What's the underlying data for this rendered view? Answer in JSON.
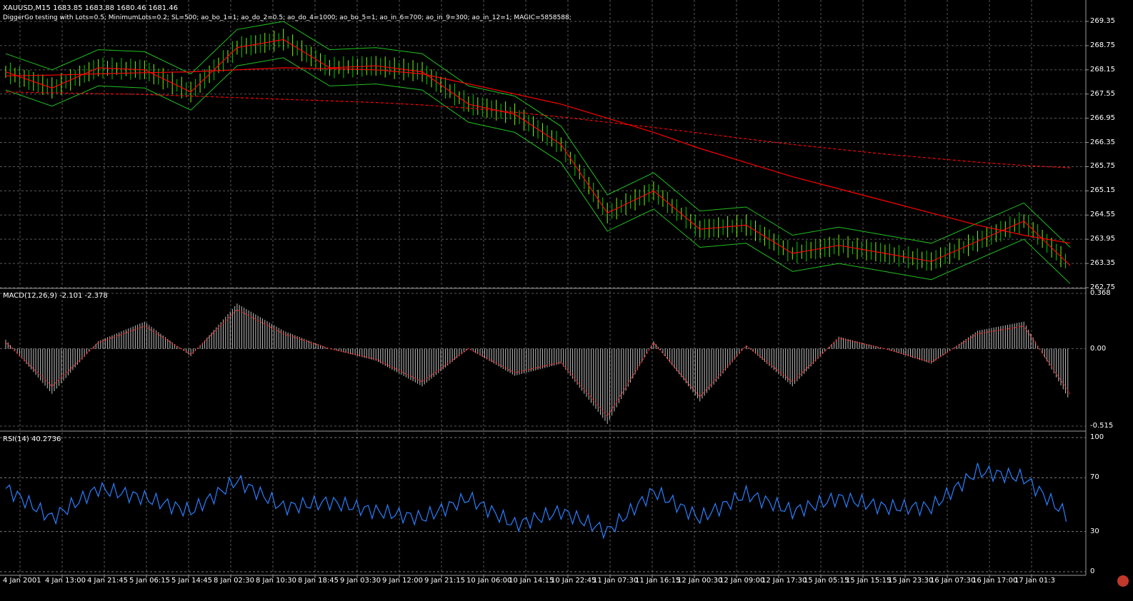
{
  "colors": {
    "background": "#000000",
    "grid": "#7f7f7f",
    "axis_text": "#ffffff",
    "candle_up": "#00d000",
    "candle_down": "#7CFC00",
    "moving_average": "#ff0000",
    "bollinger": "#20c020",
    "macd_hist": "#c0c0c0",
    "macd_signal": "#ff2020",
    "rsi_line": "#2a7fff",
    "rsi_level": "#9a9a9a"
  },
  "main_pane": {
    "symbol_label": "XAUUSD,M15  1683.85 1683.88 1680.46 1681.46",
    "ea_label": "DiggerGo testing with Lots=0.5; MinimumLots=0.2; SL=500; ao_bo_1=1; ao_do_2=0.5; ao_do_4=1000; ao_bo_5=1; ao_in_6=700; ao_in_9=300; ao_in_12=1; MAGIC=5858588;"
  },
  "macd_pane": {
    "label": "MACD(12,26,9) -2.101 -2.378"
  },
  "rsi_pane": {
    "label": "RSI(14) 40.2736"
  },
  "chart_data": [
    {
      "type": "line",
      "title": "",
      "xlabel": "",
      "ylabel": "",
      "y_ticks": [
        "269.35",
        "268.75",
        "268.15",
        "267.55",
        "266.95",
        "266.35",
        "265.75",
        "265.15",
        "264.55",
        "263.95",
        "263.35",
        "262.75"
      ],
      "ylim": [
        262.75,
        269.35
      ],
      "x": [
        "4 Jan 2001",
        "4 Jan 13:00",
        "4 Jan 21:45",
        "5 Jan 06:15",
        "5 Jan 14:45",
        "8 Jan 02:30",
        "8 Jan 10:30",
        "8 Jan 18:45",
        "9 Jan 03:30",
        "9 Jan 12:00",
        "9 Jan 21:15",
        "10 Jan 06:00",
        "10 Jan 14:15",
        "10 Jan 22:45",
        "11 Jan 07:30",
        "11 Jan 16:15",
        "12 Jan 00:30",
        "12 Jan 09:00",
        "12 Jan 17:30",
        "15 Jan 05:15",
        "15 Jan 15:15",
        "15 Jan 23:30",
        "16 Jan 07:30",
        "16 Jan 17:00"
      ],
      "x_tick_labels": [
        "4 Jan 2001",
        "4 Jan 13:00",
        "4 Jan 21:45",
        "5 Jan 06:15",
        "5 Jan 14:45",
        "8 Jan 02:30",
        "8 Jan 10:30",
        "8 Jan 18:45",
        "9 Jan 03:30",
        "9 Jan 12:00",
        "9 Jan 21:15",
        "10 Jan 06:00",
        "10 Jan 14:15",
        "10 Jan 22:45",
        "11 Jan 07:30",
        "11 Jan 16:15",
        "12 Jan 00:30",
        "12 Jan 09:00",
        "12 Jan 17:30",
        "15 Jan 05:15",
        "15 Jan 15:15",
        "15 Jan 23:30",
        "16 Jan 07:30",
        "16 Jan 17:00",
        "17 Jan 01:3"
      ],
      "series": [
        {
          "values": [
            268.1,
            267.7,
            268.2,
            268.15,
            267.6,
            268.7,
            268.9,
            268.2,
            268.25,
            268.1,
            267.3,
            267.05,
            266.3,
            264.6,
            265.15,
            264.2,
            264.3,
            263.6,
            263.8,
            263.6,
            263.4,
            263.9,
            264.4,
            263.3
          ]
        },
        {
          "values": [
            268.0,
            268.02,
            268.05,
            268.08,
            268.1,
            268.15,
            268.2,
            268.18,
            268.15,
            268.05,
            267.8,
            267.55,
            267.3,
            266.95,
            266.6,
            266.2,
            265.85,
            265.5,
            265.2,
            264.9,
            264.6,
            264.3,
            264.05,
            263.85
          ]
        },
        {
          "values": [
            267.6,
            267.58,
            267.56,
            267.54,
            267.5,
            267.46,
            267.42,
            267.38,
            267.34,
            267.28,
            267.2,
            267.1,
            266.98,
            266.85,
            266.72,
            266.58,
            266.44,
            266.3,
            266.18,
            266.06,
            265.96,
            265.86,
            265.78,
            265.72
          ]
        }
      ]
    },
    {
      "type": "bar",
      "title": "",
      "y_ticks": [
        "0.368",
        "0.00",
        "-0.515"
      ],
      "ylim": [
        -0.515,
        0.368
      ],
      "x": [
        "4 Jan 2001",
        "4 Jan 13:00",
        "4 Jan 21:45",
        "5 Jan 06:15",
        "5 Jan 14:45",
        "8 Jan 02:30",
        "8 Jan 10:30",
        "8 Jan 18:45",
        "9 Jan 03:30",
        "9 Jan 12:00",
        "9 Jan 21:15",
        "10 Jan 06:00",
        "10 Jan 14:15",
        "10 Jan 22:45",
        "11 Jan 07:30",
        "11 Jan 16:15",
        "12 Jan 00:30",
        "12 Jan 09:00",
        "12 Jan 17:30",
        "15 Jan 05:15",
        "15 Jan 15:15",
        "15 Jan 23:30",
        "16 Jan 07:30",
        "16 Jan 17:00"
      ],
      "series": [
        {
          "values": [
            0.06,
            -0.3,
            0.05,
            0.18,
            -0.05,
            0.3,
            0.12,
            0.0,
            -0.08,
            -0.25,
            0.0,
            -0.18,
            -0.1,
            -0.5,
            0.05,
            -0.35,
            0.02,
            -0.25,
            0.08,
            0.0,
            -0.1,
            0.12,
            0.18,
            -0.35
          ]
        },
        {
          "values": [
            0.04,
            -0.25,
            0.04,
            0.15,
            -0.04,
            0.26,
            0.1,
            0.0,
            -0.07,
            -0.22,
            0.0,
            -0.16,
            -0.09,
            -0.45,
            0.04,
            -0.32,
            0.02,
            -0.22,
            0.07,
            0.0,
            -0.09,
            0.1,
            0.15,
            -0.3
          ]
        }
      ]
    },
    {
      "type": "line",
      "title": "",
      "y_ticks": [
        "100",
        "70",
        "30",
        "0"
      ],
      "ylim": [
        0,
        100
      ],
      "x": [
        "4 Jan 2001",
        "4 Jan 13:00",
        "4 Jan 21:45",
        "5 Jan 06:15",
        "5 Jan 14:45",
        "8 Jan 02:30",
        "8 Jan 10:30",
        "8 Jan 18:45",
        "9 Jan 03:30",
        "9 Jan 12:00",
        "9 Jan 21:15",
        "10 Jan 06:00",
        "10 Jan 14:15",
        "10 Jan 22:45",
        "11 Jan 07:30",
        "11 Jan 16:15",
        "12 Jan 00:30",
        "12 Jan 09:00",
        "12 Jan 17:30",
        "15 Jan 05:15",
        "15 Jan 15:15",
        "15 Jan 23:30",
        "16 Jan 07:30",
        "16 Jan 17:00"
      ],
      "series": [
        {
          "values": [
            62,
            40,
            62,
            55,
            45,
            68,
            48,
            52,
            45,
            40,
            55,
            35,
            45,
            30,
            60,
            40,
            58,
            45,
            55,
            48,
            48,
            75,
            70,
            40
          ]
        }
      ]
    }
  ]
}
